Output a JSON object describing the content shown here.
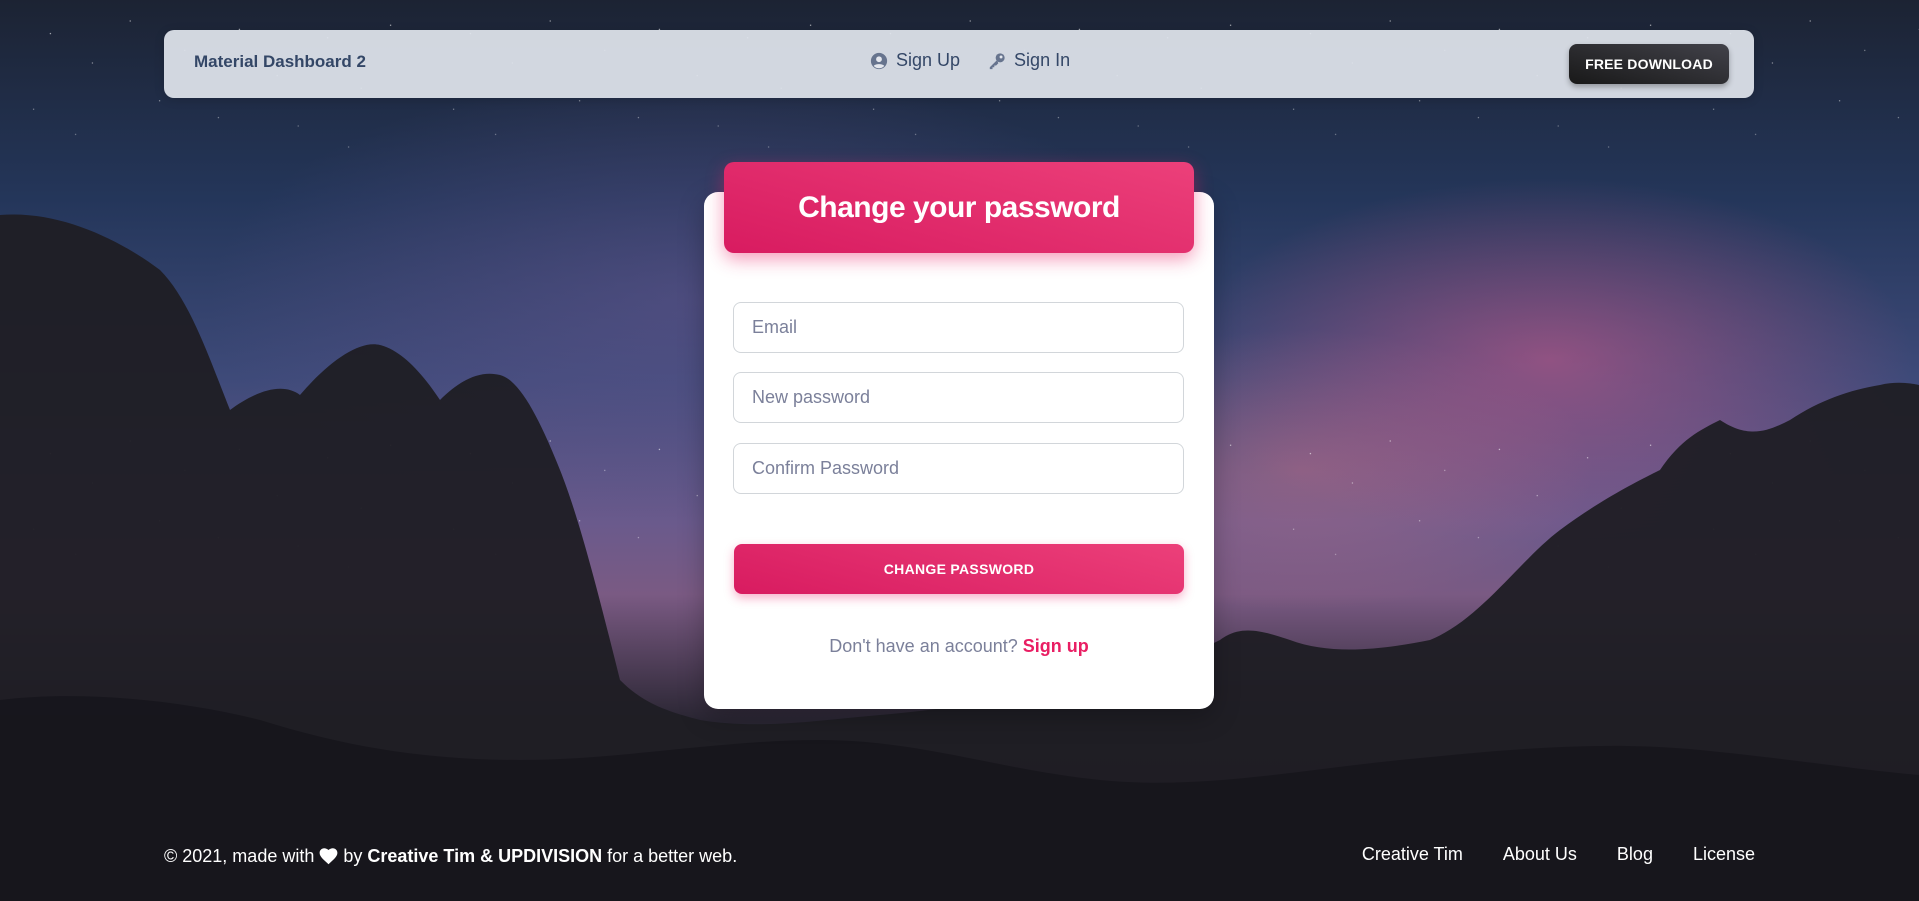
{
  "navbar": {
    "brand": "Material Dashboard 2",
    "links": [
      {
        "label": "Sign Up",
        "icon": "user-circle-icon"
      },
      {
        "label": "Sign In",
        "icon": "key-icon"
      }
    ],
    "download_label": "FREE DOWNLOAD"
  },
  "card": {
    "title": "Change your password",
    "fields": {
      "email_placeholder": "Email",
      "new_password_placeholder": "New password",
      "confirm_password_placeholder": "Confirm Password"
    },
    "submit_label": "CHANGE PASSWORD",
    "signup_prompt": "Don't have an account?",
    "signup_link": "Sign up"
  },
  "footer": {
    "copyright_prefix": "© 2021, made with",
    "by": "by",
    "authors": "Creative Tim & UPDIVISION",
    "suffix": "for a better web.",
    "links": [
      "Creative Tim",
      "About Us",
      "Blog",
      "License"
    ]
  },
  "colors": {
    "primary": "#e91e63",
    "dark": "#344767",
    "muted": "#7b809a"
  }
}
